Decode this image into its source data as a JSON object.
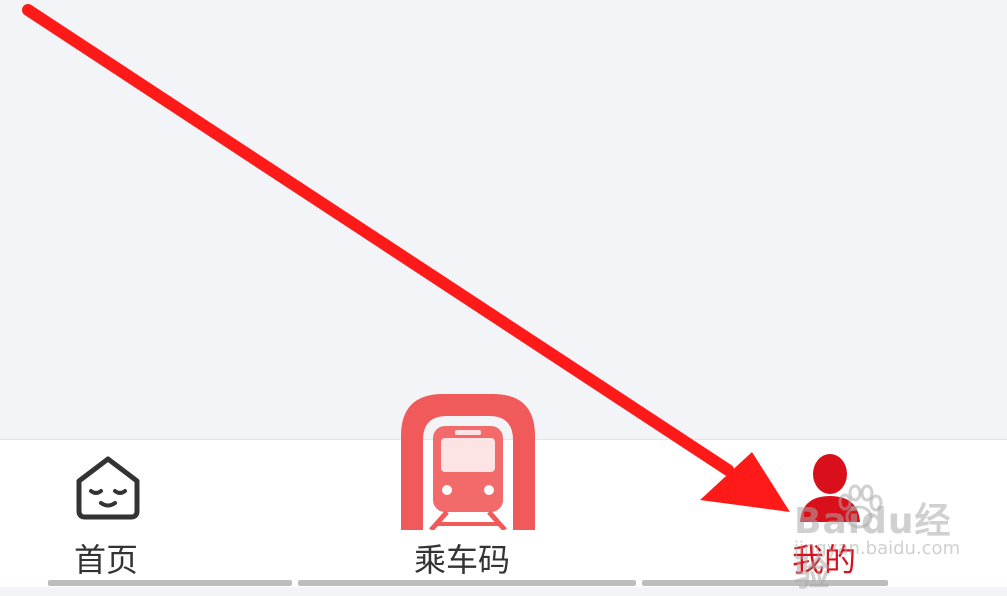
{
  "tabs": {
    "home": {
      "label": "首页",
      "icon": "house-face-icon"
    },
    "ride_code": {
      "label": "乘车码",
      "icon": "train-icon"
    },
    "mine": {
      "label": "我的",
      "icon": "user-icon",
      "selected": true
    }
  },
  "watermark": {
    "brand": "Baidu经验",
    "url": "jingyan.baidu.com"
  },
  "colors": {
    "accent": "#d90f1b",
    "train_badge": "#f05a5a",
    "arrow": "#ff1a1a",
    "background": "#f3f4f8"
  }
}
